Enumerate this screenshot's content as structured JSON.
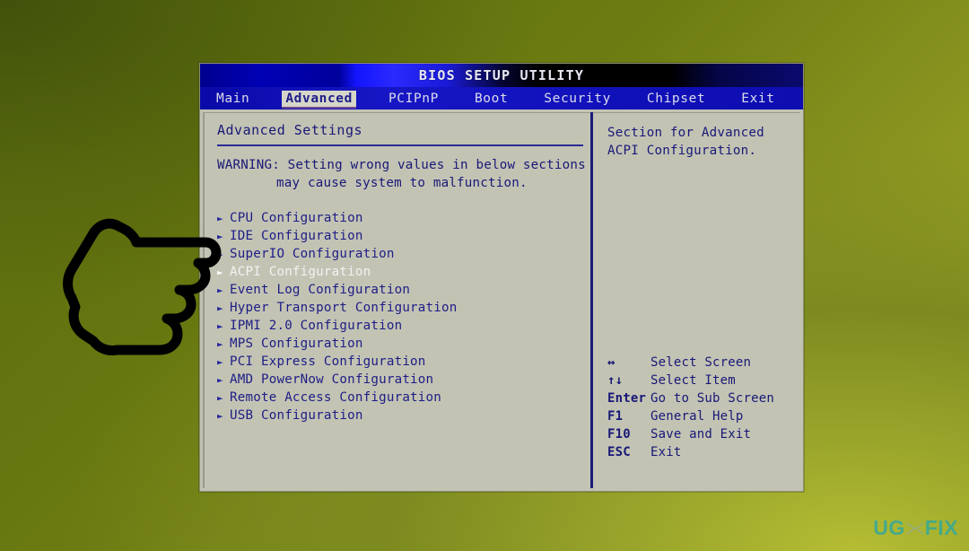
{
  "window": {
    "title": "BIOS SETUP UTILITY"
  },
  "nav": {
    "tabs": [
      {
        "label": "Main",
        "active": false
      },
      {
        "label": "Advanced",
        "active": true
      },
      {
        "label": "PCIPnP",
        "active": false
      },
      {
        "label": "Boot",
        "active": false
      },
      {
        "label": "Security",
        "active": false
      },
      {
        "label": "Chipset",
        "active": false
      },
      {
        "label": "Exit",
        "active": false
      }
    ]
  },
  "left_panel": {
    "section_title": "Advanced Settings",
    "warning_line1": "WARNING: Setting wrong values in below sections",
    "warning_line2": "may cause system to malfunction.",
    "menu_items": [
      {
        "label": "CPU Configuration",
        "selected": false
      },
      {
        "label": "IDE Configuration",
        "selected": false
      },
      {
        "label": "SuperIO Configuration",
        "selected": false
      },
      {
        "label": "ACPI Configuration",
        "selected": true
      },
      {
        "label": "Event Log Configuration",
        "selected": false
      },
      {
        "label": "Hyper Transport Configuration",
        "selected": false
      },
      {
        "label": "IPMI 2.0 Configuration",
        "selected": false
      },
      {
        "label": "MPS Configuration",
        "selected": false
      },
      {
        "label": "PCI Express Configuration",
        "selected": false
      },
      {
        "label": "AMD PowerNow Configuration",
        "selected": false
      },
      {
        "label": "Remote Access Configuration",
        "selected": false
      },
      {
        "label": "USB Configuration",
        "selected": false
      }
    ]
  },
  "right_panel": {
    "help_line1": "Section for Advanced",
    "help_line2": "ACPI Configuration.",
    "legend": [
      {
        "key": "↔",
        "desc": "Select Screen"
      },
      {
        "key": "↑↓",
        "desc": "Select Item"
      },
      {
        "key": "Enter",
        "desc": "Go to Sub Screen"
      },
      {
        "key": "F1",
        "desc": "General Help"
      },
      {
        "key": "F10",
        "desc": "Save and Exit"
      },
      {
        "key": "ESC",
        "desc": "Exit"
      }
    ]
  },
  "watermark": {
    "part1": "UG",
    "part2": "T",
    "part3": "FIX"
  },
  "colors": {
    "bios_bg": "#c3c3b4",
    "title_blue": "#0000b4",
    "tab_blue": "#1616c4",
    "text_blue": "#181878",
    "selected_white": "#f2f2f2",
    "divider": "#1b1b7a",
    "watermark_teal": "#2fa8a0"
  }
}
